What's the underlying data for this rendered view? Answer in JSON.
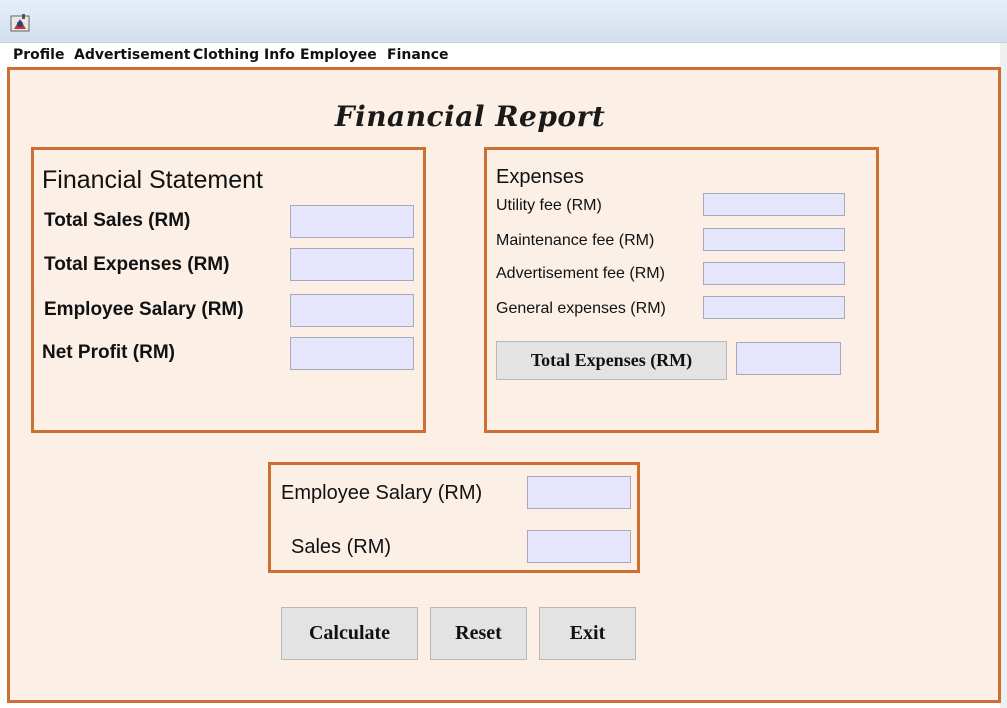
{
  "menu": {
    "items": [
      "Profile",
      "Advertisement",
      "Clothing Info",
      "Employee",
      "Finance"
    ]
  },
  "report": {
    "title": "Financial Report"
  },
  "statement": {
    "heading": "Financial Statement",
    "total_sales_label": "Total Sales (RM)",
    "total_sales_value": "",
    "total_expenses_label": "Total Expenses (RM)",
    "total_expenses_value": "",
    "employee_salary_label": "Employee Salary (RM)",
    "employee_salary_value": "",
    "net_profit_label": "Net Profit (RM)",
    "net_profit_value": ""
  },
  "expenses": {
    "heading": "Expenses",
    "utility_label": "Utility fee (RM)",
    "utility_value": "",
    "maintenance_label": "Maintenance fee (RM)",
    "maintenance_value": "",
    "advertisement_label": "Advertisement fee (RM)",
    "advertisement_value": "",
    "general_label": "General expenses (RM)",
    "general_value": "",
    "total_button": "Total Expenses (RM)",
    "total_value": ""
  },
  "inputs": {
    "employee_salary_label": "Employee Salary (RM)",
    "employee_salary_value": "",
    "sales_label": "Sales (RM)",
    "sales_value": ""
  },
  "actions": {
    "calculate": "Calculate",
    "reset": "Reset",
    "exit": "Exit"
  },
  "colors": {
    "panel_background": "#fbefe6",
    "accent_border": "#cd6e33",
    "field_background": "#e5e5fb",
    "button_background": "#e3e3e3"
  },
  "icons": {
    "window": "java-coffee-cup-icon"
  }
}
